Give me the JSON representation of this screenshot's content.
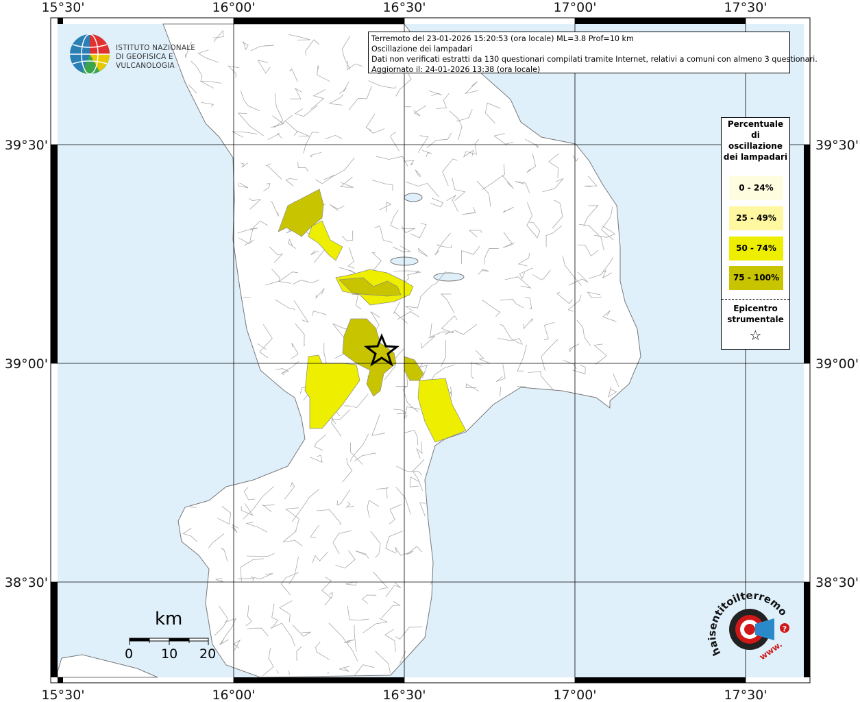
{
  "map": {
    "lon_ticks_top": [
      "15°30'",
      "16°00'",
      "16°30'",
      "17°00'",
      "17°30'"
    ],
    "lon_ticks_bottom": [
      "15°30'",
      "16°00'",
      "16°30'",
      "17°00'",
      "17°30'"
    ],
    "lat_ticks_left": [
      "39°30'",
      "39°00'",
      "38°30'"
    ],
    "lat_ticks_right": [
      "39°30'",
      "39°00'",
      "38°30'"
    ],
    "colors": {
      "sea": "#dff0fb",
      "land": "#ffffff",
      "border": "#9a9a9a",
      "class_0_24": "#fffde0",
      "class_25_49": "#fff8a0",
      "class_50_74": "#eeee00",
      "class_75_100": "#c9c400"
    }
  },
  "info": {
    "line1": "Terremoto del 23-01-2026 15:20:53 (ora locale) ML=3.8 Prof=10 km",
    "line2": "Oscillazione dei lampadari",
    "line3": "Dati non verificati estratti da 130 questionari compilati tramite Internet, relativi a comuni con almeno 3 questionari.",
    "line4": "Aggiornato il: 24-01-2026 13:38 (ora locale)"
  },
  "logo": {
    "line1": "ISTITUTO NAZIONALE",
    "line2": "DI GEOFISICA E VULCANOLOGIA"
  },
  "legend": {
    "title": "Percentuale di oscillazione dei lampadari",
    "items": [
      {
        "label": "0 - 24%",
        "color": "#fffde0"
      },
      {
        "label": "25 - 49%",
        "color": "#fff8a0"
      },
      {
        "label": "50 - 74%",
        "color": "#eeee00"
      },
      {
        "label": "75 - 100%",
        "color": "#c9c400"
      }
    ],
    "epicenter_label": "Epicentro strumentale",
    "epicenter_symbol": "☆"
  },
  "scale": {
    "unit": "km",
    "labels": [
      "0",
      "10",
      "20"
    ]
  },
  "hst_logo": {
    "text": "haisentitoilterremoto.it",
    "www": "www."
  }
}
